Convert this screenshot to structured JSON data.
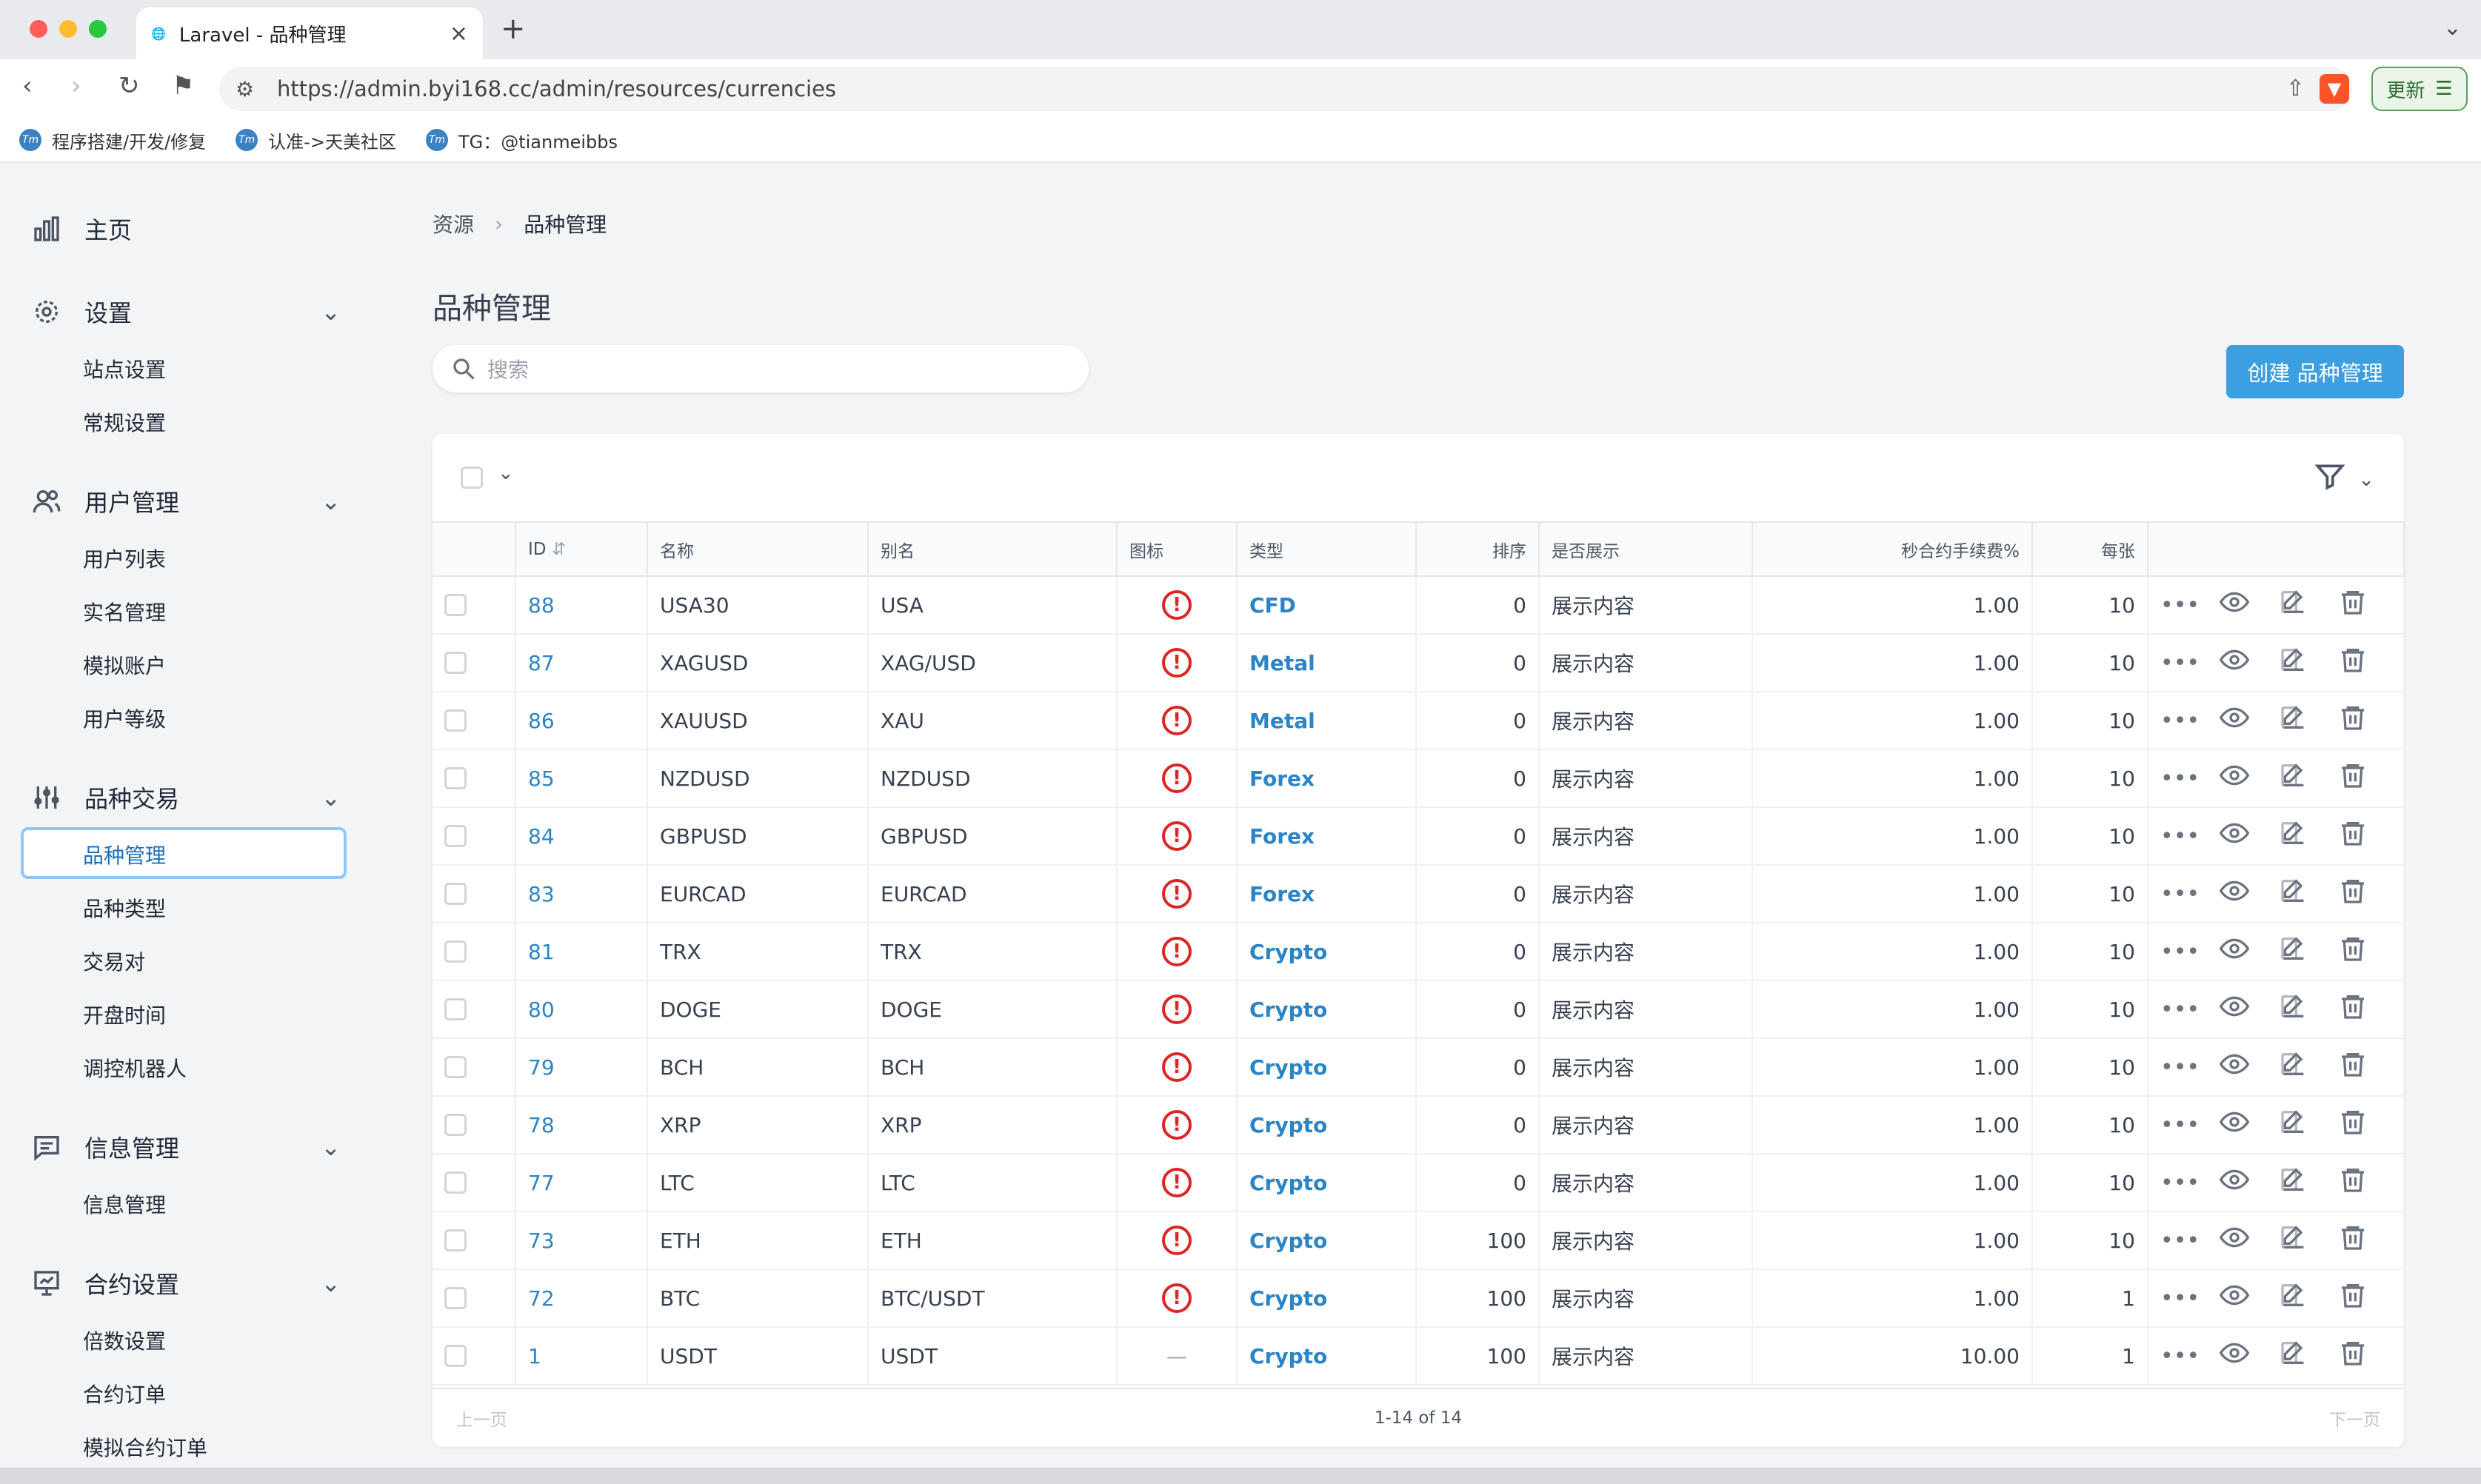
{
  "browser": {
    "tab_title": "Laravel - 品种管理",
    "url": "https://admin.byi168.cc/admin/resources/currencies",
    "update_label": "更新",
    "bookmarks": [
      "程序搭建/开发/修复",
      "认准->天美社区",
      "TG：@tianmeibbs"
    ]
  },
  "sidebar": {
    "home": "主页",
    "settings": {
      "label": "设置",
      "items": [
        "站点设置",
        "常规设置"
      ]
    },
    "users": {
      "label": "用户管理",
      "items": [
        "用户列表",
        "实名管理",
        "模拟账户",
        "用户等级"
      ]
    },
    "trading": {
      "label": "品种交易",
      "items": [
        "品种管理",
        "品种类型",
        "交易对",
        "开盘时间",
        "调控机器人"
      ]
    },
    "messages": {
      "label": "信息管理",
      "items": [
        "信息管理"
      ]
    },
    "contracts": {
      "label": "合约设置",
      "items": [
        "倍数设置",
        "合约订单",
        "模拟合约订单"
      ]
    }
  },
  "breadcrumb": {
    "root": "资源",
    "current": "品种管理"
  },
  "page_title": "品种管理",
  "search": {
    "placeholder": "搜索"
  },
  "create_button": "创建 品种管理",
  "table": {
    "columns": [
      "ID",
      "名称",
      "别名",
      "图标",
      "类型",
      "排序",
      "是否展示",
      "秒合约手续费%",
      "每张"
    ],
    "rows": [
      {
        "id": "88",
        "name": "USA30",
        "alias": "USA",
        "icon": "error",
        "type": "CFD",
        "sort": "0",
        "show": "展示内容",
        "fee": "1.00",
        "per": "10"
      },
      {
        "id": "87",
        "name": "XAGUSD",
        "alias": "XAG/USD",
        "icon": "error",
        "type": "Metal",
        "sort": "0",
        "show": "展示内容",
        "fee": "1.00",
        "per": "10"
      },
      {
        "id": "86",
        "name": "XAUUSD",
        "alias": "XAU",
        "icon": "error",
        "type": "Metal",
        "sort": "0",
        "show": "展示内容",
        "fee": "1.00",
        "per": "10"
      },
      {
        "id": "85",
        "name": "NZDUSD",
        "alias": "NZDUSD",
        "icon": "error",
        "type": "Forex",
        "sort": "0",
        "show": "展示内容",
        "fee": "1.00",
        "per": "10"
      },
      {
        "id": "84",
        "name": "GBPUSD",
        "alias": "GBPUSD",
        "icon": "error",
        "type": "Forex",
        "sort": "0",
        "show": "展示内容",
        "fee": "1.00",
        "per": "10"
      },
      {
        "id": "83",
        "name": "EURCAD",
        "alias": "EURCAD",
        "icon": "error",
        "type": "Forex",
        "sort": "0",
        "show": "展示内容",
        "fee": "1.00",
        "per": "10"
      },
      {
        "id": "81",
        "name": "TRX",
        "alias": "TRX",
        "icon": "error",
        "type": "Crypto",
        "sort": "0",
        "show": "展示内容",
        "fee": "1.00",
        "per": "10"
      },
      {
        "id": "80",
        "name": "DOGE",
        "alias": "DOGE",
        "icon": "error",
        "type": "Crypto",
        "sort": "0",
        "show": "展示内容",
        "fee": "1.00",
        "per": "10"
      },
      {
        "id": "79",
        "name": "BCH",
        "alias": "BCH",
        "icon": "error",
        "type": "Crypto",
        "sort": "0",
        "show": "展示内容",
        "fee": "1.00",
        "per": "10"
      },
      {
        "id": "78",
        "name": "XRP",
        "alias": "XRP",
        "icon": "error",
        "type": "Crypto",
        "sort": "0",
        "show": "展示内容",
        "fee": "1.00",
        "per": "10"
      },
      {
        "id": "77",
        "name": "LTC",
        "alias": "LTC",
        "icon": "error",
        "type": "Crypto",
        "sort": "0",
        "show": "展示内容",
        "fee": "1.00",
        "per": "10"
      },
      {
        "id": "73",
        "name": "ETH",
        "alias": "ETH",
        "icon": "error",
        "type": "Crypto",
        "sort": "100",
        "show": "展示内容",
        "fee": "1.00",
        "per": "10"
      },
      {
        "id": "72",
        "name": "BTC",
        "alias": "BTC/USDT",
        "icon": "error",
        "type": "Crypto",
        "sort": "100",
        "show": "展示内容",
        "fee": "1.00",
        "per": "1"
      },
      {
        "id": "1",
        "name": "USDT",
        "alias": "USDT",
        "icon": "none",
        "type": "Crypto",
        "sort": "100",
        "show": "展示内容",
        "fee": "10.00",
        "per": "1"
      }
    ]
  },
  "pagination": {
    "prev": "上一页",
    "info": "1-14 of 14",
    "next": "下一页"
  },
  "colors": {
    "accent": "#3b9fe0",
    "link": "#2b84c6",
    "error": "#dc2626"
  }
}
